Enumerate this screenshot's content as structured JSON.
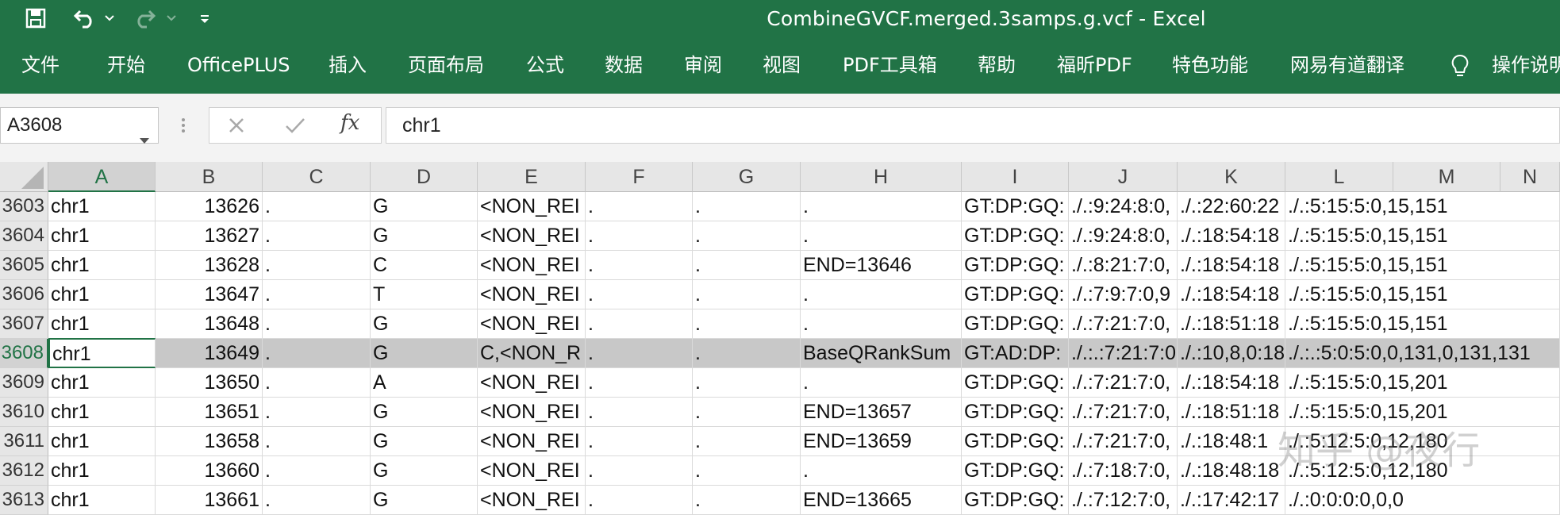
{
  "titlebar": {
    "title": "CombineGVCF.merged.3samps.g.vcf  -  Excel",
    "icons": [
      "save-icon",
      "undo-icon",
      "redo-icon",
      "customize-qat-icon"
    ]
  },
  "ribbon": {
    "tabs": [
      "文件",
      "开始",
      "OfficePLUS",
      "插入",
      "页面布局",
      "公式",
      "数据",
      "审阅",
      "视图",
      "PDF工具箱",
      "帮助",
      "福昕PDF",
      "特色功能",
      "网易有道翻译",
      "操作说明"
    ],
    "tell_me_icon": "lightbulb-icon"
  },
  "formula_bar": {
    "name_box": "A3608",
    "fx_label": "fx",
    "content": "chr1"
  },
  "columns": [
    "A",
    "B",
    "C",
    "D",
    "E",
    "F",
    "G",
    "H",
    "I",
    "J",
    "K",
    "L",
    "M",
    "N"
  ],
  "rows": [
    {
      "n": "3603",
      "A": "chr1",
      "B": "13626",
      "C": ".",
      "D": "G",
      "E": "<NON_REI",
      "F": ".",
      "G": ".",
      "H": ".",
      "I": "GT:DP:GQ:",
      "J": "./.:9:24:8:0,",
      "K": "./.:22:60:22",
      "L": "./.:5:15:5:0,15,151"
    },
    {
      "n": "3604",
      "A": "chr1",
      "B": "13627",
      "C": ".",
      "D": "G",
      "E": "<NON_REI",
      "F": ".",
      "G": ".",
      "H": ".",
      "I": "GT:DP:GQ:",
      "J": "./.:9:24:8:0,",
      "K": "./.:18:54:18",
      "L": "./.:5:15:5:0,15,151"
    },
    {
      "n": "3605",
      "A": "chr1",
      "B": "13628",
      "C": ".",
      "D": "C",
      "E": "<NON_REI",
      "F": ".",
      "G": ".",
      "H": "END=13646",
      "I": "GT:DP:GQ:",
      "J": "./.:8:21:7:0,",
      "K": "./.:18:54:18",
      "L": "./.:5:15:5:0,15,151"
    },
    {
      "n": "3606",
      "A": "chr1",
      "B": "13647",
      "C": ".",
      "D": "T",
      "E": "<NON_REI",
      "F": ".",
      "G": ".",
      "H": ".",
      "I": "GT:DP:GQ:",
      "J": "./.:7:9:7:0,9",
      "K": "./.:18:54:18",
      "L": "./.:5:15:5:0,15,151"
    },
    {
      "n": "3607",
      "A": "chr1",
      "B": "13648",
      "C": ".",
      "D": "G",
      "E": "<NON_REI",
      "F": ".",
      "G": ".",
      "H": ".",
      "I": "GT:DP:GQ:",
      "J": "./.:7:21:7:0,",
      "K": "./.:18:51:18",
      "L": "./.:5:15:5:0,15,151"
    },
    {
      "n": "3608",
      "A": "chr1",
      "B": "13649",
      "C": ".",
      "D": "G",
      "E": "C,<NON_R",
      "F": ".",
      "G": ".",
      "H": "BaseQRankSum",
      "I": "GT:AD:DP:",
      "J": "./.:.:7:21:7:0",
      "K": "./.:10,8,0:18",
      "L": "./.:.:5:0:5:0,0,131,0,131,131"
    },
    {
      "n": "3609",
      "A": "chr1",
      "B": "13650",
      "C": ".",
      "D": "A",
      "E": "<NON_REI",
      "F": ".",
      "G": ".",
      "H": ".",
      "I": "GT:DP:GQ:",
      "J": "./.:7:21:7:0,",
      "K": "./.:18:54:18",
      "L": "./.:5:15:5:0,15,201"
    },
    {
      "n": "3610",
      "A": "chr1",
      "B": "13651",
      "C": ".",
      "D": "G",
      "E": "<NON_REI",
      "F": ".",
      "G": ".",
      "H": "END=13657",
      "I": "GT:DP:GQ:",
      "J": "./.:7:21:7:0,",
      "K": "./.:18:51:18",
      "L": "./.:5:15:5:0,15,201"
    },
    {
      "n": "3611",
      "A": "chr1",
      "B": "13658",
      "C": ".",
      "D": "G",
      "E": "<NON_REI",
      "F": ".",
      "G": ".",
      "H": "END=13659",
      "I": "GT:DP:GQ:",
      "J": "./.:7:21:7:0,",
      "K": "./.:18:48:1",
      "L": "./.:5:12:5:0,12,180"
    },
    {
      "n": "3612",
      "A": "chr1",
      "B": "13660",
      "C": ".",
      "D": "G",
      "E": "<NON_REI",
      "F": ".",
      "G": ".",
      "H": ".",
      "I": "GT:DP:GQ:",
      "J": "./.:7:18:7:0,",
      "K": "./.:18:48:18",
      "L": "./.:5:12:5:0,12,180"
    },
    {
      "n": "3613",
      "A": "chr1",
      "B": "13661",
      "C": ".",
      "D": "G",
      "E": "<NON_REI",
      "F": ".",
      "G": ".",
      "H": "END=13665",
      "I": "GT:DP:GQ:",
      "J": "./.:7:12:7:0,",
      "K": "./.:17:42:17",
      "L": "./.:0:0:0:0,0,0"
    }
  ],
  "selected_row_index": 5,
  "watermark": "知乎 @夜行",
  "colors": {
    "excel_green": "#217346",
    "header_gray": "#e6e6e6",
    "selection_gray": "#c8c8c8"
  }
}
